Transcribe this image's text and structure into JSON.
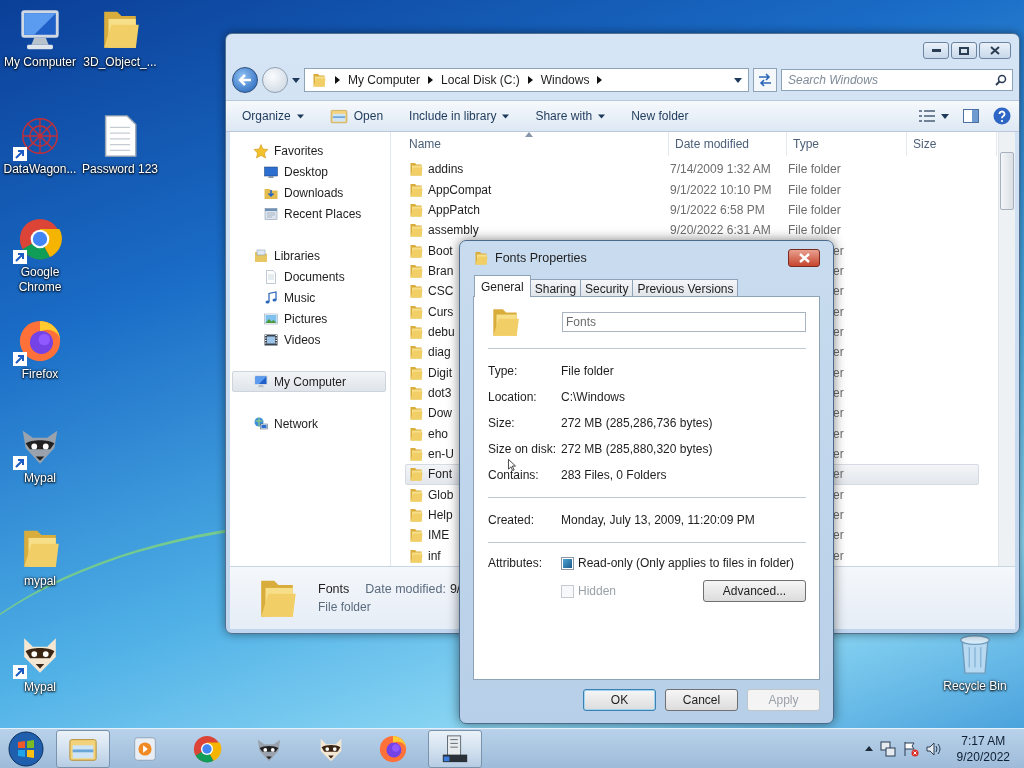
{
  "desktop_icons": [
    {
      "label": "My Computer",
      "kind": "computer",
      "shortcut": false
    },
    {
      "label": "3D_Object_...",
      "kind": "folder",
      "shortcut": false
    },
    {
      "label": "DataWagon...",
      "kind": "mesh",
      "shortcut": true
    },
    {
      "label": "Password 123",
      "kind": "document",
      "shortcut": false
    },
    {
      "label": "Google Chrome",
      "kind": "chrome",
      "shortcut": true
    },
    {
      "label": "Firefox",
      "kind": "firefox",
      "shortcut": true
    },
    {
      "label": "Mypal",
      "kind": "raccoon",
      "shortcut": true
    },
    {
      "label": "mypal",
      "kind": "folder",
      "shortcut": false
    },
    {
      "label": "Mypal",
      "kind": "raccoon2",
      "shortcut": true
    },
    {
      "label": "Recycle Bin",
      "kind": "recycle",
      "shortcut": false
    }
  ],
  "explorer": {
    "crumbs": [
      "My Computer",
      "Local Disk (C:)",
      "Windows"
    ],
    "search": {
      "placeholder": "Search Windows"
    },
    "toolbar": [
      {
        "label": "Organize",
        "kind": "menu"
      },
      {
        "label": "Open",
        "kind": "open"
      },
      {
        "label": "Include in library",
        "kind": "menu"
      },
      {
        "label": "Share with",
        "kind": "menu"
      },
      {
        "label": "New folder",
        "kind": "plain"
      }
    ],
    "nav": [
      {
        "label": "Favorites",
        "kind": "star",
        "selected": false,
        "children": [
          {
            "label": "Desktop",
            "kind": "desktop",
            "selected": false
          },
          {
            "label": "Downloads",
            "kind": "download",
            "selected": false
          },
          {
            "label": "Recent Places",
            "kind": "recent",
            "selected": false
          }
        ]
      },
      {
        "label": "Libraries",
        "kind": "library",
        "selected": false,
        "children": [
          {
            "label": "Documents",
            "kind": "documents",
            "selected": false
          },
          {
            "label": "Music",
            "kind": "music",
            "selected": false
          },
          {
            "label": "Pictures",
            "kind": "pictures",
            "selected": false
          },
          {
            "label": "Videos",
            "kind": "videos",
            "selected": false
          }
        ]
      },
      {
        "label": "My Computer",
        "kind": "computer",
        "selected": true
      },
      {
        "label": "Network",
        "kind": "network",
        "selected": false
      }
    ],
    "columns": [
      "Name",
      "Date modified",
      "Type",
      "Size"
    ],
    "rows": [
      {
        "name": "addins",
        "date": "7/14/2009 1:32 AM",
        "type": "File folder",
        "selected": false,
        "covered": false
      },
      {
        "name": "AppCompat",
        "date": "9/1/2022 10:10 PM",
        "type": "File folder",
        "selected": false,
        "covered": false
      },
      {
        "name": "AppPatch",
        "date": "9/1/2022 6:58 PM",
        "type": "File folder",
        "selected": false,
        "covered": false
      },
      {
        "name": "assembly",
        "date": "9/20/2022 6:31 AM",
        "type": "File folder",
        "selected": false,
        "covered": false
      },
      {
        "name": "Boot",
        "type": "er",
        "selected": false,
        "covered": true
      },
      {
        "name": "Bran",
        "type": "er",
        "selected": false,
        "covered": true
      },
      {
        "name": "CSC",
        "type": "er",
        "selected": false,
        "covered": true
      },
      {
        "name": "Curs",
        "type": "er",
        "selected": false,
        "covered": true
      },
      {
        "name": "debu",
        "type": "er",
        "selected": false,
        "covered": true
      },
      {
        "name": "diag",
        "type": "er",
        "selected": false,
        "covered": true
      },
      {
        "name": "Digit",
        "type": "er",
        "selected": false,
        "covered": true
      },
      {
        "name": "dot3",
        "type": "er",
        "selected": false,
        "covered": true
      },
      {
        "name": "Dow",
        "type": "er",
        "selected": false,
        "covered": true
      },
      {
        "name": "eho",
        "type": "er",
        "selected": false,
        "covered": true
      },
      {
        "name": "en-U",
        "type": "er",
        "selected": false,
        "covered": true
      },
      {
        "name": "Font",
        "type": "er",
        "selected": true,
        "covered": true
      },
      {
        "name": "Glob",
        "type": "er",
        "selected": false,
        "covered": true
      },
      {
        "name": "Help",
        "type": "er",
        "selected": false,
        "covered": true
      },
      {
        "name": "IME",
        "type": "er",
        "selected": false,
        "covered": true
      },
      {
        "name": "inf",
        "type": "er",
        "selected": false,
        "covered": true
      }
    ],
    "details": {
      "name": "Fonts",
      "date_label": "Date modified:",
      "date_value": "9/",
      "type": "File folder"
    }
  },
  "dialog": {
    "title": "Fonts Properties",
    "tabs": [
      {
        "label": "General",
        "selected": true
      },
      {
        "label": "Sharing",
        "selected": false
      },
      {
        "label": "Security",
        "selected": false
      },
      {
        "label": "Previous Versions",
        "selected": false
      }
    ],
    "name_value": "Fonts",
    "groups": [
      [
        {
          "label": "Type:",
          "value": "File folder"
        },
        {
          "label": "Location:",
          "value": "C:\\Windows"
        },
        {
          "label": "Size:",
          "value": "272 MB (285,286,736 bytes)"
        },
        {
          "label": "Size on disk:",
          "value": "272 MB (285,880,320 bytes)"
        },
        {
          "label": "Contains:",
          "value": "283 Files, 0 Folders"
        }
      ],
      [
        {
          "label": "Created:",
          "value": "Monday, July 13, 2009, 11:20:09 PM"
        }
      ]
    ],
    "attributes": {
      "label": "Attributes:",
      "options": [
        {
          "label": "Read-only (Only applies to files in folder)",
          "checked": true,
          "disabled": false
        },
        {
          "label": "Hidden",
          "checked": false,
          "disabled": true
        }
      ],
      "advanced": "Advanced..."
    },
    "buttons": [
      {
        "label": "OK",
        "default": true,
        "disabled": false
      },
      {
        "label": "Cancel",
        "default": false,
        "disabled": false
      },
      {
        "label": "Apply",
        "default": false,
        "disabled": true
      }
    ]
  },
  "taskbar": {
    "items": [
      {
        "kind": "explorer",
        "active": true
      },
      {
        "kind": "media",
        "active": false
      },
      {
        "kind": "chrome",
        "active": false
      },
      {
        "kind": "raccoon",
        "active": false
      },
      {
        "kind": "raccoon2",
        "active": false
      },
      {
        "kind": "firefox",
        "active": false
      },
      {
        "kind": "properties",
        "active": true
      }
    ],
    "time": "7:17 AM",
    "date": "9/20/2022"
  }
}
